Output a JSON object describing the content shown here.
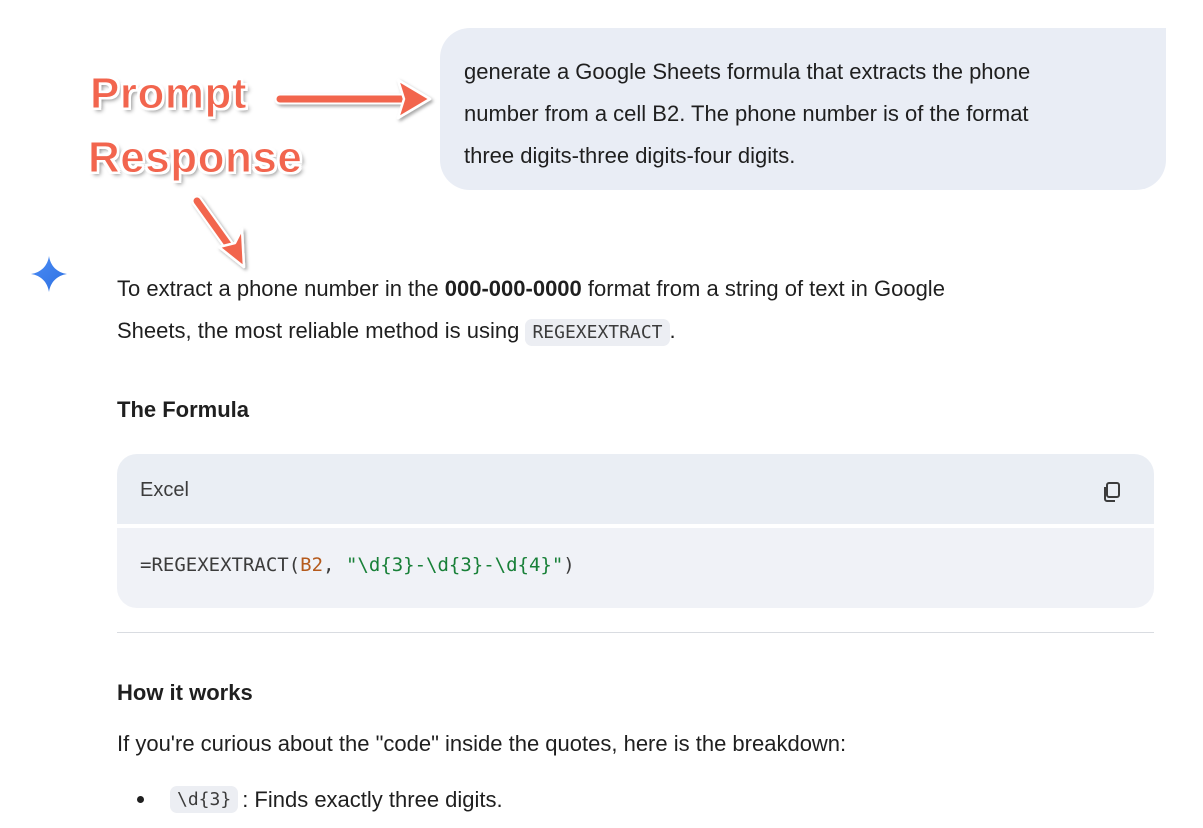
{
  "annotations": {
    "prompt_label": "Prompt",
    "response_label": "Response",
    "color": "#f2654e"
  },
  "prompt": {
    "lines": [
      "generate a Google Sheets formula that extracts the phone",
      "number from a cell B2. The phone number is of the format",
      "three digits-three digits-four digits."
    ]
  },
  "response": {
    "icon": "gemini-sparkle-icon",
    "intro": {
      "part1": "To extract a phone number in the ",
      "bold": "000-000-0000",
      "part2": " format from a string of text in Google",
      "part3": "Sheets, the most reliable method is using ",
      "code": "REGEXEXTRACT",
      "part4": "."
    },
    "formula_heading": "The Formula",
    "code_block": {
      "language": "Excel",
      "copy_icon": "copy-icon",
      "fn": "=REGEXEXTRACT(",
      "ref": "B2",
      "sep": ", ",
      "str": "\"\\d{3}-\\d{3}-\\d{4}\"",
      "close": ")"
    },
    "how_heading": "How it works",
    "how_text": "If you're curious about the \"code\" inside the quotes, here is the breakdown:",
    "bullets": [
      {
        "code": "\\d{3}",
        "text": ": Finds exactly three digits."
      }
    ]
  }
}
